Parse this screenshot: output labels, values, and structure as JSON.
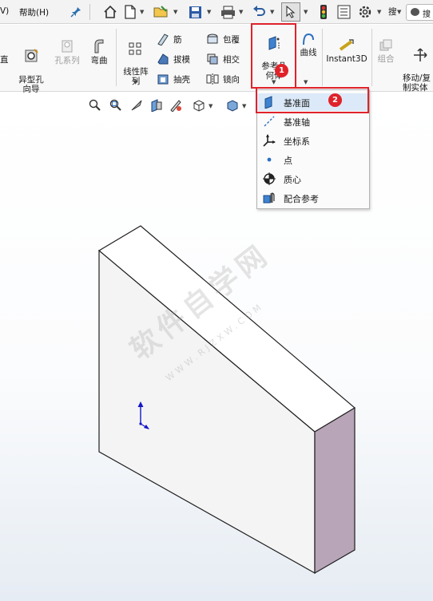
{
  "menu": {
    "view_partial": "V)",
    "help": "帮助(H)"
  },
  "search": {
    "placeholder": "搜"
  },
  "ribbon": {
    "features_left": [
      {
        "label": "直"
      },
      {
        "label": "异型孔\n向导"
      },
      {
        "label": "孔系列",
        "disabled": true
      },
      {
        "label": "弯曲"
      }
    ],
    "linear_pattern": "线性阵\n列",
    "small_col1": [
      "筋",
      "拔模",
      "抽壳"
    ],
    "small_col2": [
      "包覆",
      "相交",
      "镜向"
    ],
    "ref_geometry": "参考几\n何体",
    "curves": "曲线",
    "instant3d": "Instant3D",
    "combine": "组合",
    "move_copy": "移动/复\n制实体"
  },
  "dropdown": {
    "items": [
      {
        "label": "基准面",
        "icon": "plane-icon"
      },
      {
        "label": "基准轴",
        "icon": "axis-icon"
      },
      {
        "label": "坐标系",
        "icon": "coordinate-system-icon"
      },
      {
        "label": "点",
        "icon": "point-icon"
      },
      {
        "label": "质心",
        "icon": "center-of-mass-icon"
      },
      {
        "label": "配合参考",
        "icon": "mate-reference-icon"
      }
    ]
  },
  "annotations": {
    "step1": "1",
    "step2": "2"
  },
  "watermark": {
    "main": "软件自学网",
    "sub": "WWW.RJZXW.COM"
  },
  "colors": {
    "highlight_red": "#e0222a",
    "block_top": "#ffffff",
    "block_front": "#f4f4f4",
    "block_side": "#b8a5b7",
    "triad_blue": "#1515c8"
  }
}
